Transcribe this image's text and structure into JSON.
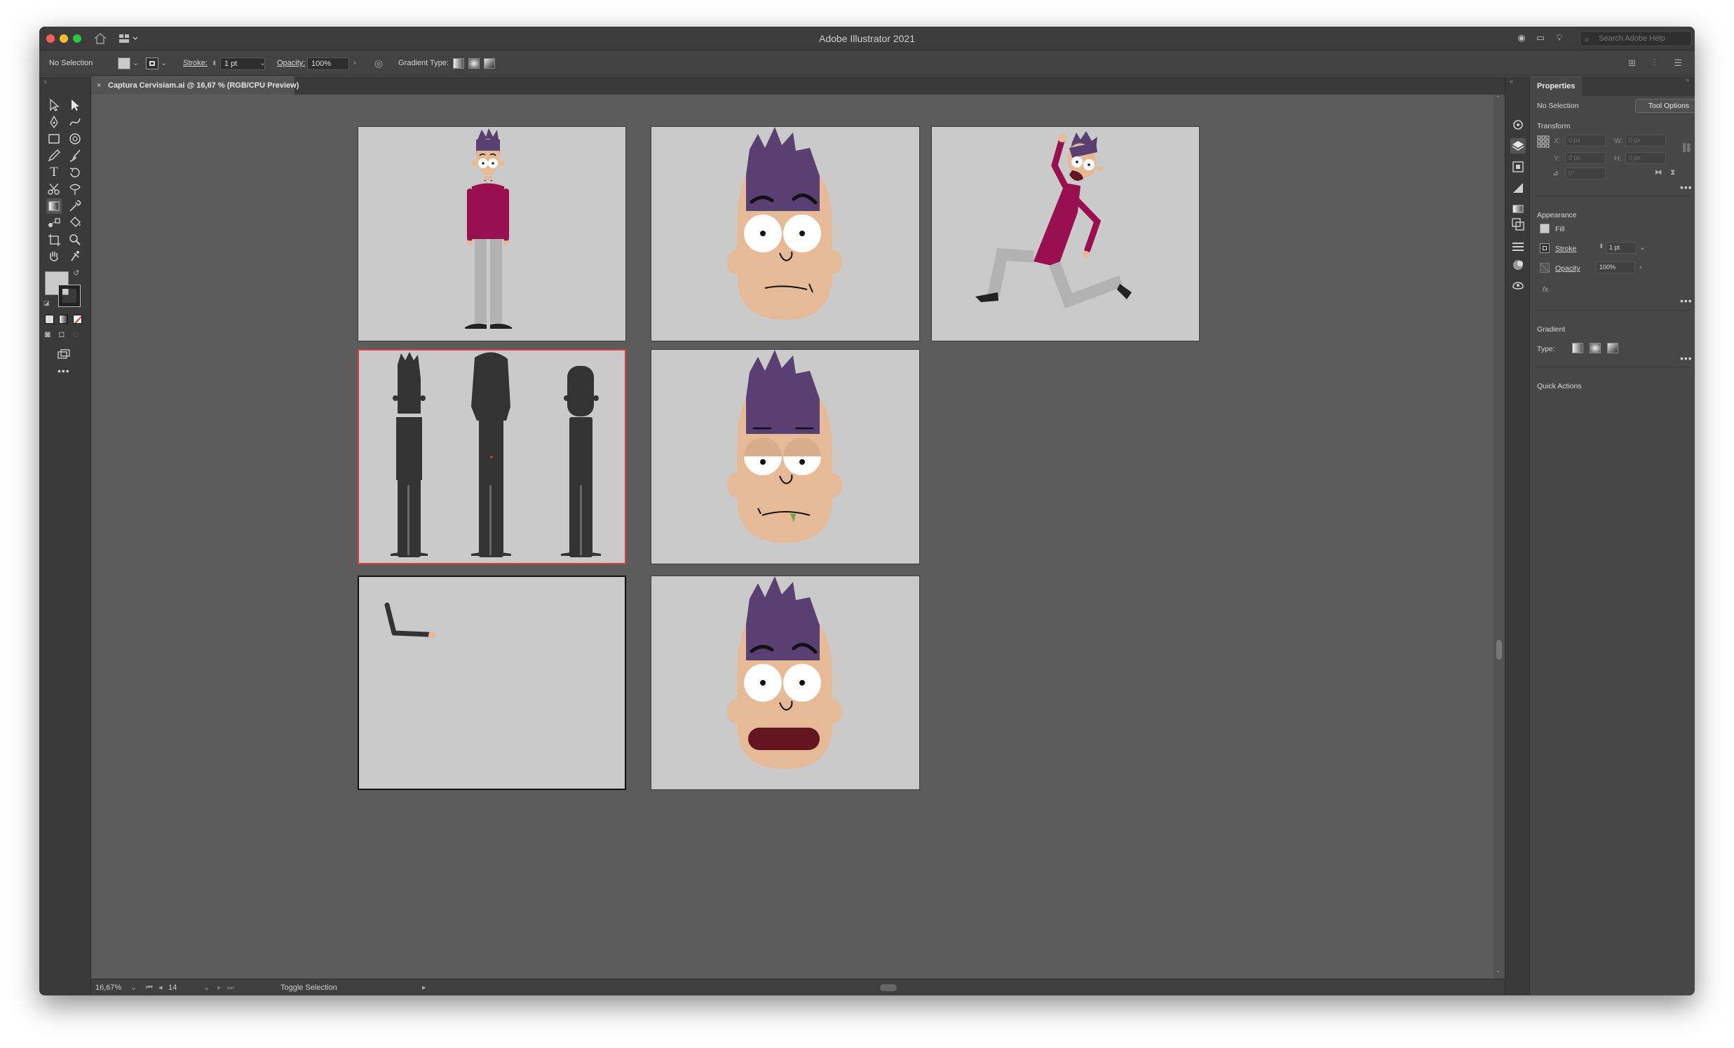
{
  "window": {
    "title": "Adobe Illustrator 2021",
    "search_placeholder": "Search Adobe Help"
  },
  "control_bar": {
    "selection_label": "No Selection",
    "stroke_label": "Stroke:",
    "stroke_value": "1 pt",
    "opacity_label": "Opacity:",
    "opacity_value": "100%",
    "gradient_type_label": "Gradient Type:"
  },
  "document_tab": {
    "title": "Captura Cervisiam.ai @ 16,67 % (RGB/CPU Preview)"
  },
  "status_bar": {
    "zoom": "16,67%",
    "artboard_number": "14",
    "mode_label": "Toggle Selection"
  },
  "properties_panel": {
    "tab_label": "Properties",
    "selection_label": "No Selection",
    "tool_options_button": "Tool Options",
    "transform_heading": "Transform",
    "x_label": "X:",
    "y_label": "Y:",
    "w_label": "W:",
    "h_label": "H:",
    "x_placeholder": "0 px",
    "y_placeholder": "0 px",
    "w_placeholder": "0 px",
    "h_placeholder": "0 px",
    "angle_placeholder": "0°",
    "appearance_heading": "Appearance",
    "fill_label": "Fill",
    "stroke_label": "Stroke",
    "stroke_value": "1 pt",
    "opacity_label": "Opacity",
    "opacity_value": "100%",
    "fx_label": "fx.",
    "gradient_heading": "Gradient",
    "type_label": "Type:",
    "quick_actions_heading": "Quick Actions"
  },
  "colors": {
    "shirt": "#9a0f50",
    "hair": "#5a3f73",
    "skin": "#e6b997",
    "pants": "#b2b2b2",
    "silhouette": "#333333",
    "mouth_dark": "#641520",
    "tongue": "#6aa84f",
    "artboard": "#cacaca",
    "canvas": "#5c5c5c"
  }
}
